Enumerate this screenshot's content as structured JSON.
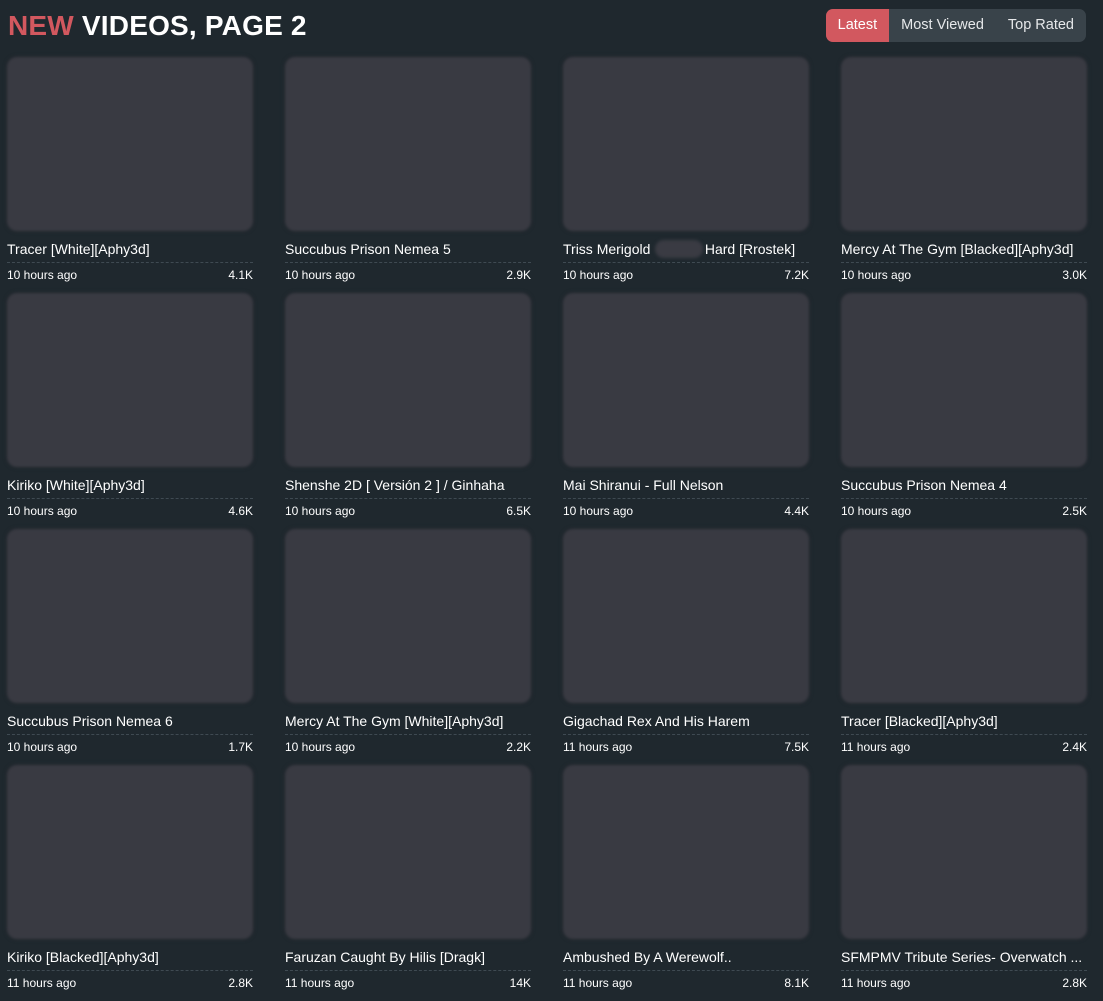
{
  "header": {
    "title_accent": "NEW",
    "title_rest": " VIDEOS, PAGE 2"
  },
  "sort_tabs": [
    {
      "label": "Latest",
      "active": true
    },
    {
      "label": "Most Viewed",
      "active": false
    },
    {
      "label": "Top Rated",
      "active": false
    }
  ],
  "colors": {
    "accent": "#d2585f",
    "background": "#1f282e",
    "thumbnail_placeholder": "#393a42"
  },
  "videos": [
    {
      "title": "Tracer [White][Aphy3d]",
      "time": "10 hours ago",
      "views": "4.1K"
    },
    {
      "title": "Succubus Prison Nemea 5",
      "time": "10 hours ago",
      "views": "2.9K"
    },
    {
      "title": "Triss Merigold              Hard [Rrostek]",
      "time": "10 hours ago",
      "views": "7.2K",
      "redacted_part": true
    },
    {
      "title": "Mercy At The Gym [Blacked][Aphy3d]",
      "time": "10 hours ago",
      "views": "3.0K"
    },
    {
      "title": "Kiriko [White][Aphy3d]",
      "time": "10 hours ago",
      "views": "4.6K"
    },
    {
      "title": "Shenshe 2D [ Versión 2 ] / Ginhaha",
      "time": "10 hours ago",
      "views": "6.5K"
    },
    {
      "title": "Mai Shiranui - Full Nelson",
      "time": "10 hours ago",
      "views": "4.4K"
    },
    {
      "title": "Succubus Prison Nemea 4",
      "time": "10 hours ago",
      "views": "2.5K"
    },
    {
      "title": "Succubus Prison Nemea 6",
      "time": "10 hours ago",
      "views": "1.7K"
    },
    {
      "title": "Mercy At The Gym [White][Aphy3d]",
      "time": "10 hours ago",
      "views": "2.2K"
    },
    {
      "title": "Gigachad Rex And His Harem",
      "time": "11 hours ago",
      "views": "7.5K"
    },
    {
      "title": "Tracer [Blacked][Aphy3d]",
      "time": "11 hours ago",
      "views": "2.4K"
    },
    {
      "title": "Kiriko [Blacked][Aphy3d]",
      "time": "11 hours ago",
      "views": "2.8K"
    },
    {
      "title": "Faruzan Caught By Hilis [Dragk]",
      "time": "11 hours ago",
      "views": "14K"
    },
    {
      "title": "Ambushed By A Werewolf..",
      "time": "11 hours ago",
      "views": "8.1K"
    },
    {
      "title": "SFMPMV Tribute Series- Overwatch ...",
      "time": "11 hours ago",
      "views": "2.8K"
    }
  ]
}
